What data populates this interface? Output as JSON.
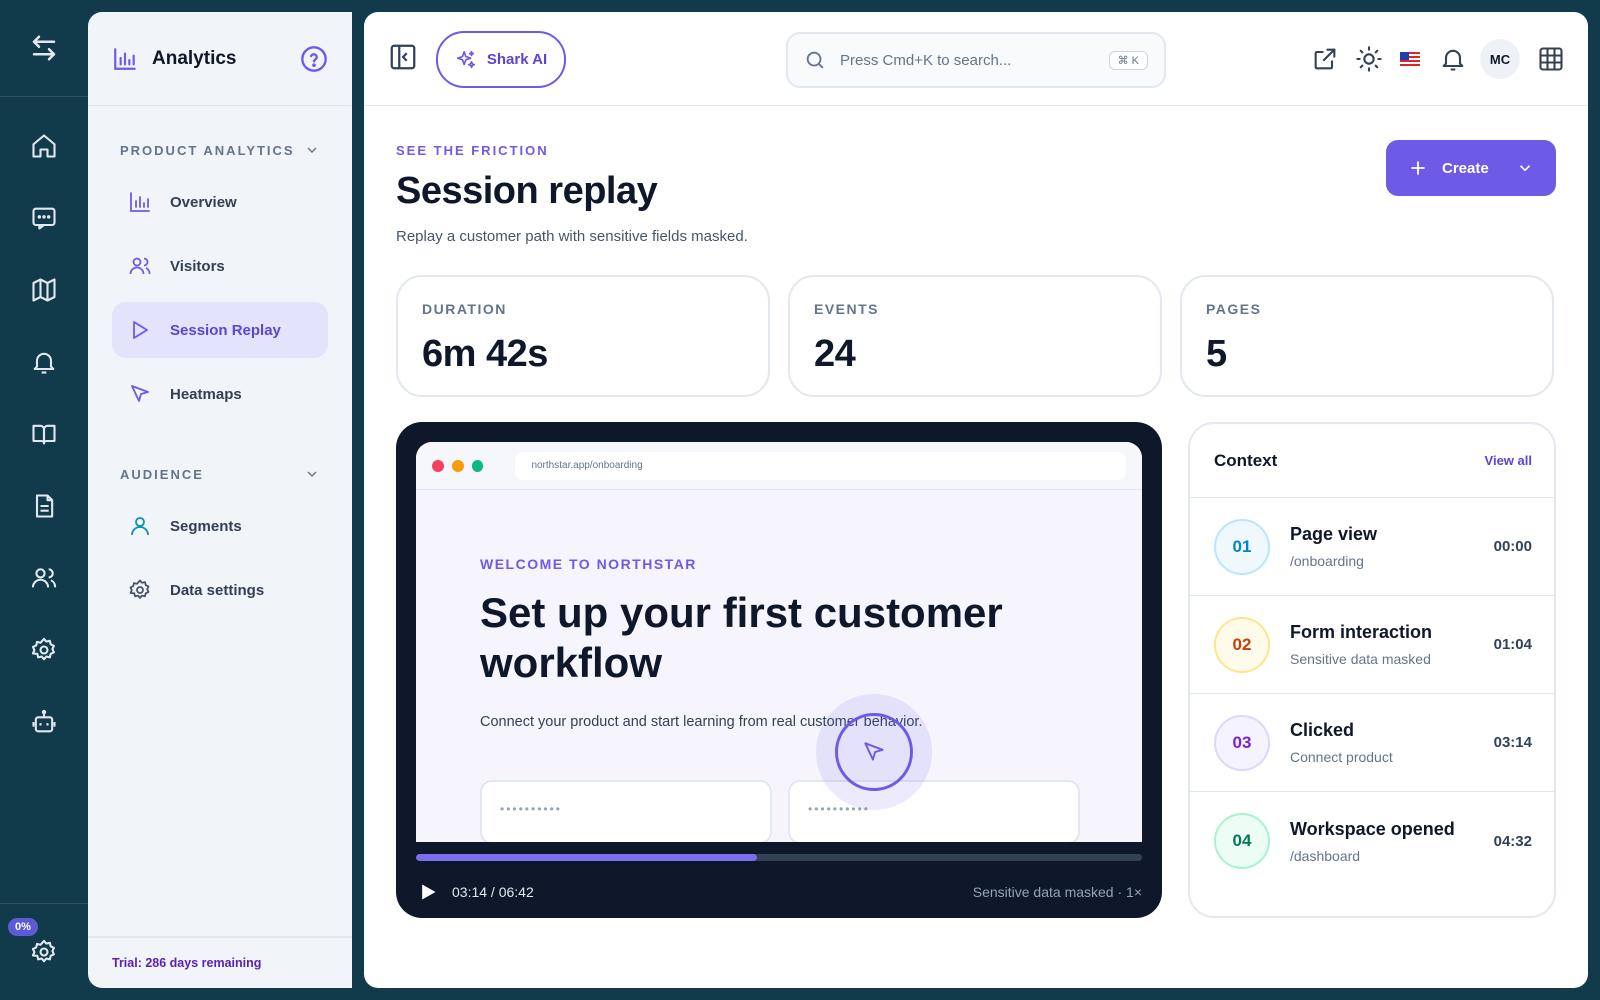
{
  "rail": {
    "progress_badge": "0%",
    "icons": [
      "swap-arrows-icon",
      "home-icon",
      "chat-icon",
      "map-icon",
      "bell-icon",
      "book-icon",
      "document-icon",
      "users-icon",
      "settings-icon",
      "robot-icon"
    ]
  },
  "sidebar": {
    "title": "Analytics",
    "sections": [
      {
        "label": "PRODUCT ANALYTICS",
        "items": [
          {
            "label": "Overview",
            "icon": "bar-chart-icon",
            "active": false
          },
          {
            "label": "Visitors",
            "icon": "users-icon",
            "active": false
          },
          {
            "label": "Session Replay",
            "icon": "play-icon",
            "active": true
          },
          {
            "label": "Heatmaps",
            "icon": "cursor-icon",
            "active": false
          }
        ]
      },
      {
        "label": "AUDIENCE",
        "items": [
          {
            "label": "Segments",
            "icon": "user-icon",
            "active": false
          },
          {
            "label": "Data settings",
            "icon": "gear-icon",
            "active": false
          }
        ]
      }
    ],
    "footer": "Trial: 286 days remaining"
  },
  "topbar": {
    "shark_label": "Shark AI",
    "search_placeholder": "Press Cmd+K to search...",
    "search_shortcut": "⌘ K",
    "avatar_initials": "MC"
  },
  "page": {
    "eyebrow": "SEE THE FRICTION",
    "title": "Session replay",
    "subtitle": "Replay a customer path with sensitive fields masked.",
    "create_label": "Create"
  },
  "stats": [
    {
      "label": "DURATION",
      "value": "6m 42s"
    },
    {
      "label": "EVENTS",
      "value": "24"
    },
    {
      "label": "PAGES",
      "value": "5"
    }
  ],
  "player": {
    "url": "northstar.app/onboarding",
    "eyebrow": "WELCOME TO NORTHSTAR",
    "headline": "Set up your first customer workflow",
    "body": "Connect your product and start learning from real customer behavior.",
    "masked_value": "••••••••••",
    "progress_fraction": 0.47,
    "time": "03:14 / 06:42",
    "note": "Sensitive data masked · 1×"
  },
  "context": {
    "title": "Context",
    "view_all": "View all",
    "events": [
      {
        "num": "01",
        "name": "Page view",
        "detail": "/onboarding",
        "time": "00:00",
        "color": "#0284c7",
        "bg": "#eef8fd",
        "border": "#bae6fd"
      },
      {
        "num": "02",
        "name": "Form interaction",
        "detail": "Sensitive data masked",
        "time": "01:04",
        "color": "#c2410c",
        "bg": "#fffbeb",
        "border": "#fde68a"
      },
      {
        "num": "03",
        "name": "Clicked",
        "detail": "Connect product",
        "time": "03:14",
        "color": "#7e22ce",
        "bg": "#f5f3ff",
        "border": "#ddd6fe"
      },
      {
        "num": "04",
        "name": "Workspace opened",
        "detail": "/dashboard",
        "time": "04:32",
        "color": "#047857",
        "bg": "#ecfdf5",
        "border": "#a7f3d0"
      }
    ]
  },
  "colors": {
    "accent": "#6d5ae6",
    "rail_bg": "#113a4b"
  }
}
